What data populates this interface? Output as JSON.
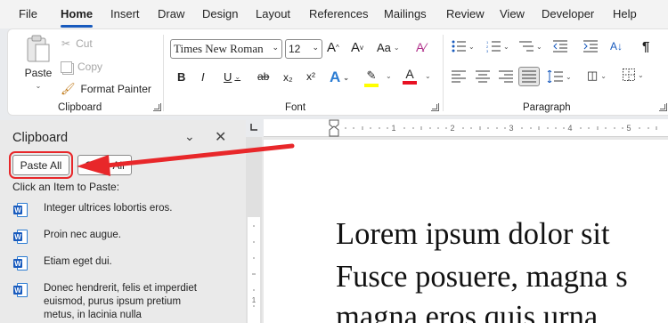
{
  "menu": {
    "items": [
      {
        "label": "File",
        "name": "menu-file"
      },
      {
        "label": "Home",
        "name": "menu-home"
      },
      {
        "label": "Insert",
        "name": "menu-insert"
      },
      {
        "label": "Draw",
        "name": "menu-draw"
      },
      {
        "label": "Design",
        "name": "menu-design"
      },
      {
        "label": "Layout",
        "name": "menu-layout"
      },
      {
        "label": "References",
        "name": "menu-references"
      },
      {
        "label": "Mailings",
        "name": "menu-mailings"
      },
      {
        "label": "Review",
        "name": "menu-review"
      },
      {
        "label": "View",
        "name": "menu-view"
      },
      {
        "label": "Developer",
        "name": "menu-developer"
      },
      {
        "label": "Help",
        "name": "menu-help"
      }
    ],
    "active": "Home"
  },
  "clipboard_group": {
    "paste_label": "Paste",
    "cut_label": "Cut",
    "copy_label": "Copy",
    "format_painter_label": "Format Painter",
    "group_label": "Clipboard"
  },
  "font_group": {
    "font_name": "Times New Roman",
    "font_size": "12",
    "group_label": "Font",
    "bold": "B",
    "italic": "I",
    "underline": "U",
    "strike": "ab",
    "subscript": "x₂",
    "superscript": "x²",
    "change_case": "Aa",
    "grow": "A",
    "shrink": "A",
    "effects": "A",
    "font_color": "A"
  },
  "paragraph_group": {
    "group_label": "Paragraph",
    "pilcrow": "¶"
  },
  "clipboard_pane": {
    "title": "Clipboard",
    "paste_all": "Paste All",
    "clear_all": "Clear All",
    "hint": "Click an Item to Paste:",
    "items": [
      "Integer ultrices lobortis eros.",
      "Proin nec augue.",
      "Etiam eget dui.",
      "Donec hendrerit, felis et imperdiet euismod, purus ipsum pretium metus, in lacinia nulla"
    ]
  },
  "document": {
    "lines": [
      "Lorem ipsum dolor sit",
      "Fusce posuere, magna s",
      "magna eros quis urna"
    ]
  },
  "colors": {
    "accent": "#185abd",
    "highlight_annotation": "#e8272a",
    "highlighter": "#ffff00",
    "font_color": "#e81123"
  }
}
